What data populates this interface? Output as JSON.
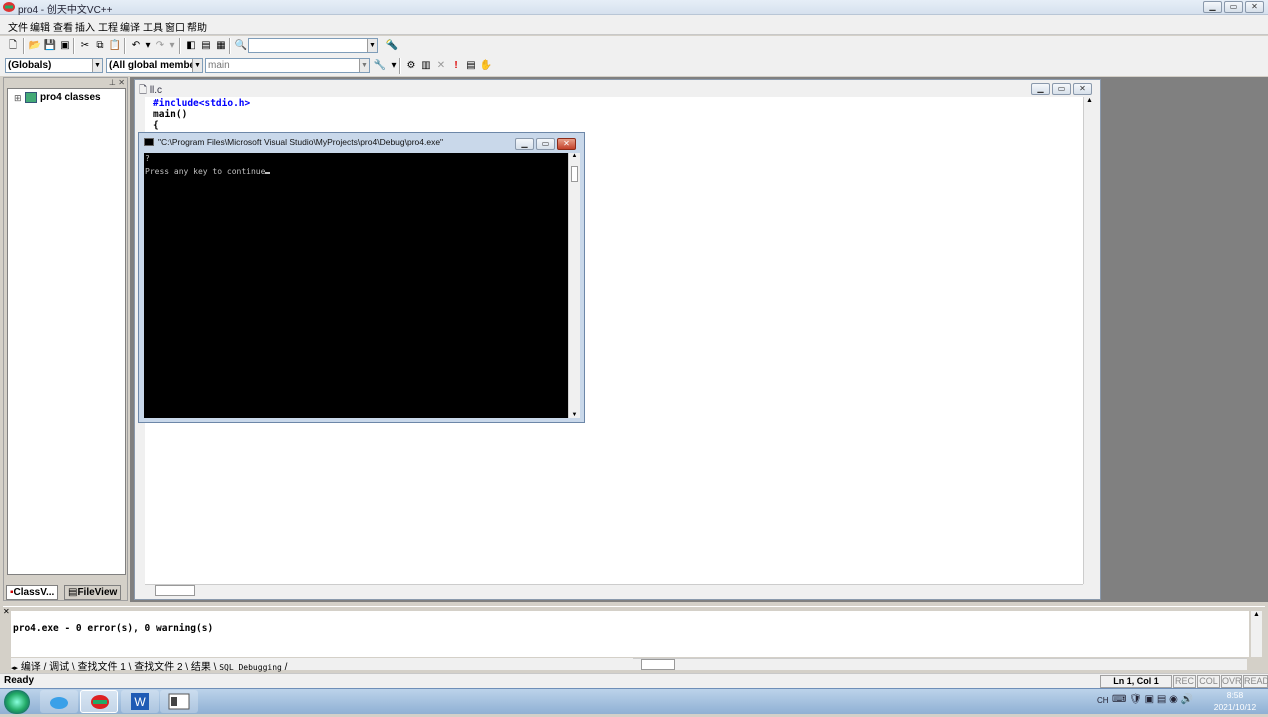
{
  "window": {
    "title": "pro4 - 创天中文VC++"
  },
  "menu": [
    "文件",
    "编辑",
    "查看",
    "插入",
    "工程",
    "编译",
    "工具",
    "窗口",
    "帮助"
  ],
  "toolbar": {
    "find_combo_value": "",
    "scope_combo": "(Globals)",
    "members_combo": "(All global members",
    "function_combo": "main"
  },
  "workspace": {
    "tree_root": "pro4 classes",
    "tabs": [
      "ClassV...",
      "FileView"
    ]
  },
  "editor": {
    "file_title": "ll.c",
    "code_lines": [
      "#include<stdio.h>",
      "main()",
      "{"
    ]
  },
  "console": {
    "title": "\"C:\\Program Files\\Microsoft Visual Studio\\MyProjects\\pro4\\Debug\\pro4.exe\"",
    "lines": [
      "?",
      "Press any key to continue"
    ]
  },
  "output": {
    "text": "pro4.exe - 0 error(s), 0 warning(s)",
    "tabs": [
      "编译",
      "调试",
      "查找文件 1",
      "查找文件 2",
      "结果",
      "SQL Debugging"
    ]
  },
  "status": {
    "text": "Ready",
    "position": "Ln 1, Col 1",
    "indicators": [
      "REC",
      "COL",
      "OVR",
      "READ"
    ]
  },
  "taskbar": {
    "lang": "CH",
    "time": "8:58",
    "date": "2021/10/12"
  }
}
